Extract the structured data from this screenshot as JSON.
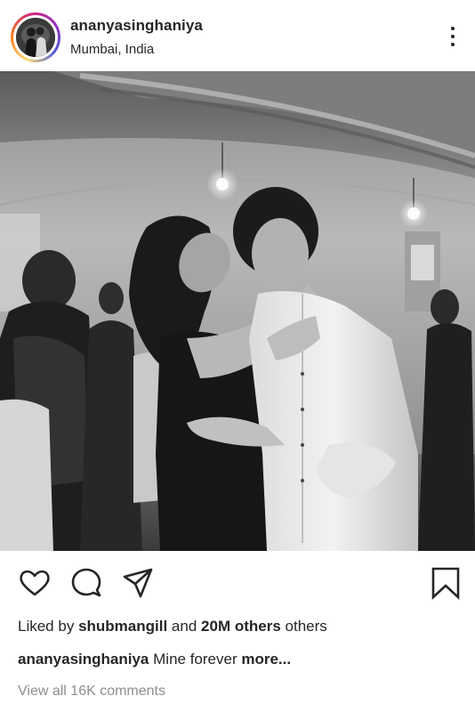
{
  "post": {
    "username": "ananyasinghaniya",
    "location": "Mumbai, India"
  },
  "icons": {
    "more": "more-options-icon",
    "like": "heart-icon",
    "comment": "comment-icon",
    "share": "send-icon",
    "save": "bookmark-icon"
  },
  "likes": {
    "prefix": "Liked by",
    "user": "shubmangill",
    "conjunction": "and",
    "count": "20M others",
    "suffix": "others"
  },
  "caption": {
    "user": "ananyasinghaniya",
    "text": "Mine forever",
    "more_label": "more..."
  },
  "comments": {
    "view_all": "View all 16K comments"
  },
  "colors": {
    "text": "#262626",
    "muted": "#8e8e8e",
    "ring_start": "#feda75",
    "ring_mid": "#d62976",
    "ring_end": "#4f5bd5"
  }
}
